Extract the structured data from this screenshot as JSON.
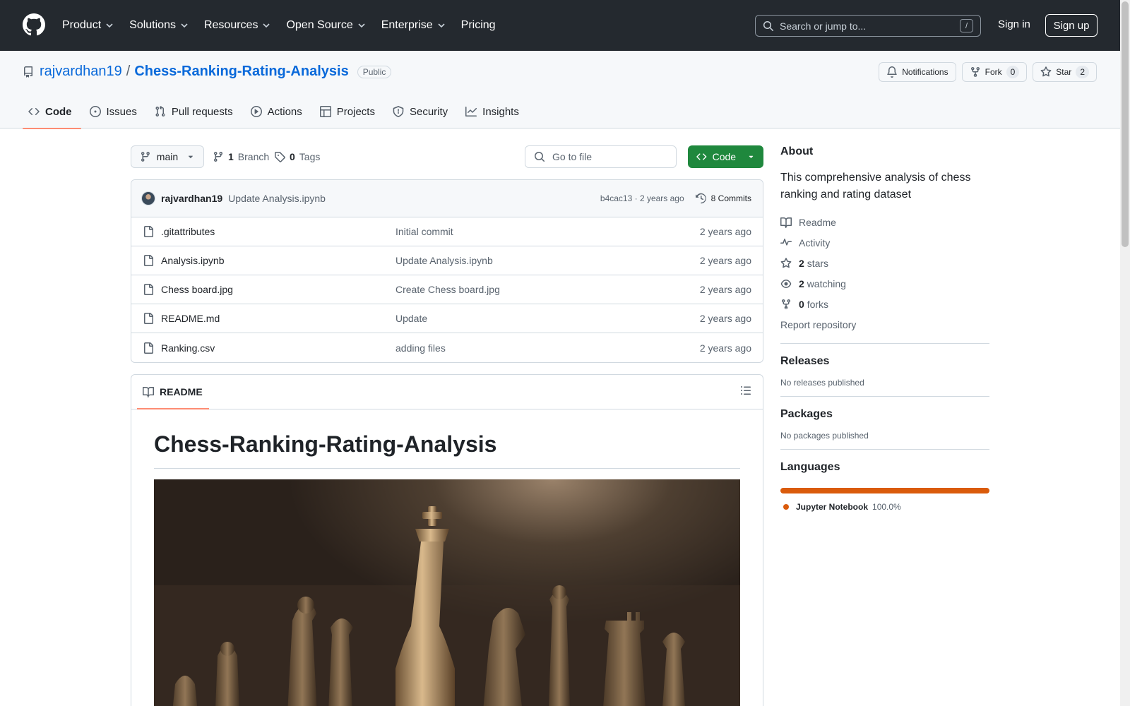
{
  "header": {
    "nav": [
      "Product",
      "Solutions",
      "Resources",
      "Open Source",
      "Enterprise",
      "Pricing"
    ],
    "search_placeholder": "Search or jump to...",
    "search_key": "/",
    "signin": "Sign in",
    "signup": "Sign up"
  },
  "repo": {
    "owner": "rajvardhan19",
    "separator": "/",
    "name": "Chess-Ranking-Rating-Analysis",
    "visibility": "Public",
    "notifications_label": "Notifications",
    "fork_label": "Fork",
    "fork_count": "0",
    "star_label": "Star",
    "star_count": "2"
  },
  "tabs": [
    "Code",
    "Issues",
    "Pull requests",
    "Actions",
    "Projects",
    "Security",
    "Insights"
  ],
  "toolbar": {
    "branch": "main",
    "branch_count": "1",
    "branch_label": "Branch",
    "tag_count": "0",
    "tag_label": "Tags",
    "goto_placeholder": "Go to file",
    "code_label": "Code"
  },
  "commit": {
    "author": "rajvardhan19",
    "message": "Update Analysis.ipynb",
    "hash_time": "b4cac13 · 2 years ago",
    "commits": "8 Commits"
  },
  "files": [
    {
      "name": ".gitattributes",
      "message": "Initial commit",
      "age": "2 years ago"
    },
    {
      "name": "Analysis.ipynb",
      "message": "Update Analysis.ipynb",
      "age": "2 years ago"
    },
    {
      "name": "Chess board.jpg",
      "message": "Create Chess board.jpg",
      "age": "2 years ago"
    },
    {
      "name": "README.md",
      "message": "Update",
      "age": "2 years ago"
    },
    {
      "name": "Ranking.csv",
      "message": "adding files",
      "age": "2 years ago"
    }
  ],
  "readme": {
    "tab": "README",
    "title": "Chess-Ranking-Rating-Analysis"
  },
  "about": {
    "title": "About",
    "description": "This comprehensive analysis of chess ranking and rating dataset",
    "readme": "Readme",
    "activity": "Activity",
    "stars_count": "2",
    "stars_label": "stars",
    "watching_count": "2",
    "watching_label": "watching",
    "forks_count": "0",
    "forks_label": "forks",
    "report": "Report repository"
  },
  "releases": {
    "title": "Releases",
    "text": "No releases published"
  },
  "packages": {
    "title": "Packages",
    "text": "No packages published"
  },
  "languages": {
    "title": "Languages",
    "items": [
      {
        "name": "Jupyter Notebook",
        "percent": "100.0%",
        "share": 100,
        "color": "#DA5B0B"
      }
    ]
  },
  "colors": {
    "accent_link": "#0969da",
    "code_button": "#1f883d",
    "tab_underline": "#fd8c73",
    "header_bg": "#24292f"
  }
}
